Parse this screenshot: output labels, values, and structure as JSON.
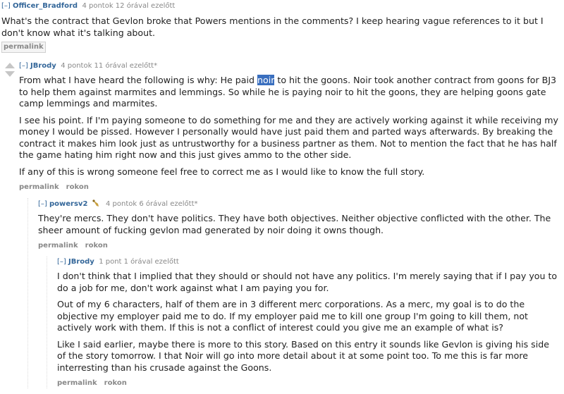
{
  "c1": {
    "toggle": "[–]",
    "author": "Officer_Bradford",
    "meta": "4 pontok 12 órával ezelőtt",
    "paragraphs": [
      "What's the contract that Gevlon broke that Powers mentions in the comments? I keep hearing vague references to it but I don't know what it's talking about."
    ],
    "permalink": "permalink"
  },
  "c2": {
    "toggle": "[–]",
    "author": "JBrody",
    "meta": "4 pontok 11 órával ezelőtt*",
    "p1_before": "From what I have heard the following is why: He paid ",
    "p1_highlight": "noir",
    "p1_after": " to hit the goons. Noir took another contract from goons for BJ3 to help them against marmites and lemmings. So while he is paying noir to hit the goons, they are helping goons gate camp lemmings and marmites.",
    "p2": "I see his point. If I'm paying someone to do something for me and they are actively working against it while receiving my money I would be pissed. However I personally would have just paid them and parted ways afterwards. By breaking the contract it makes him look just as untrustworthy for a business partner as them. Not to mention the fact that he has half the game hating him right now and this just gives ammo to the other side.",
    "p3": "If any of this is wrong someone feel free to correct me as I would like to know the full story.",
    "permalink": "permalink",
    "parent": "rokon"
  },
  "c3": {
    "toggle": "[–]",
    "author": "powersv2",
    "flair_icon": "horn-flair-icon",
    "meta": "4 pontok 6 órával ezelőtt*",
    "paragraphs": [
      "They're mercs. They don't have politics. They have both objectives. Neither objective conflicted with the other. The sheer amount of fucking gevlon mad generated by noir doing it owns though."
    ],
    "permalink": "permalink",
    "parent": "rokon"
  },
  "c4": {
    "toggle": "[–]",
    "author": "JBrody",
    "meta": "1 pont 1 órával ezelőtt",
    "paragraphs": [
      "I don't think that I implied that they should or should not have any politics. I'm merely saying that if I pay you to do a job for me, don't work against what I am paying you for.",
      "Out of my 6 characters, half of them are in 3 different merc corporations. As a merc, my goal is to do the objective my employer paid me to do. If my employer paid me to kill one group I'm going to kill them, not actively work with them. If this is not a conflict of interest could you give me an example of what is?",
      "Like I said earlier, maybe there is more to this story. Based on this entry it sounds like Gevlon is giving his side of the story tomorrow. I that Noir will go into more detail about it at some point too. To me this is far more interresting than his crusade against the Goons."
    ],
    "permalink": "permalink",
    "parent": "rokon"
  },
  "colors": {
    "link": "#336699",
    "meta": "#888888",
    "text": "#222222",
    "highlight": "#3a6fbf"
  }
}
